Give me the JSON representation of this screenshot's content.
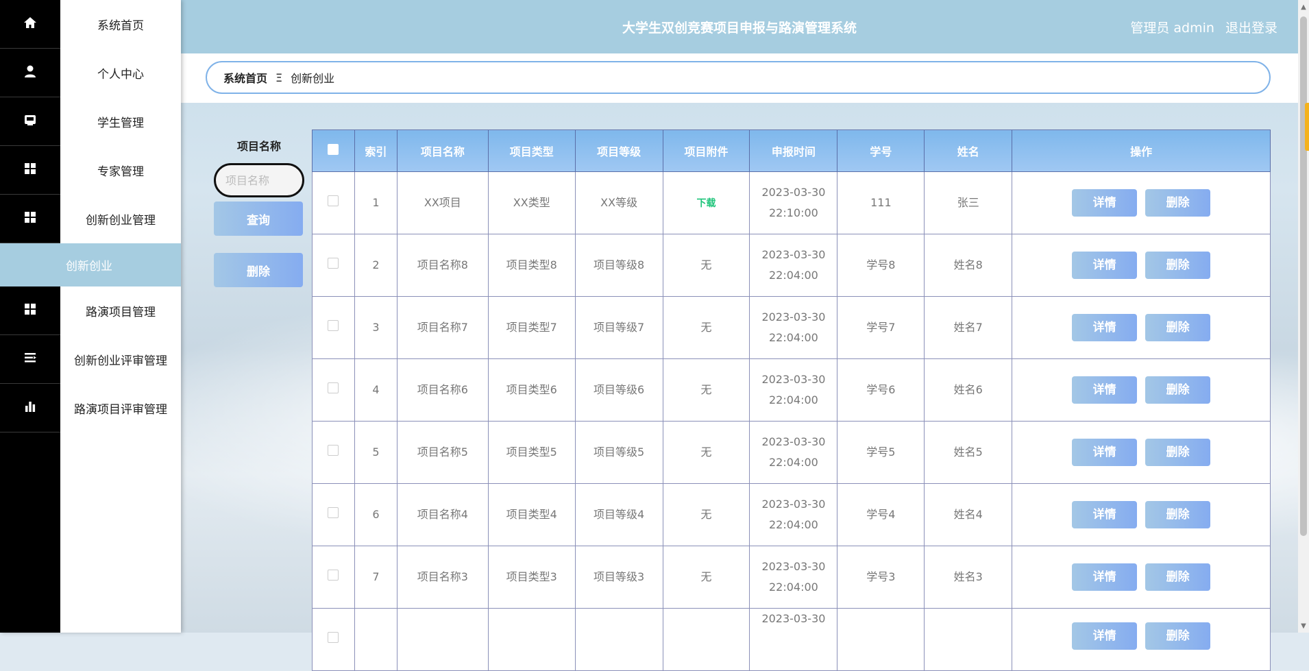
{
  "sidebar": {
    "items": [
      {
        "label": "系统首页",
        "icon": "home-icon"
      },
      {
        "label": "个人中心",
        "icon": "user-icon"
      },
      {
        "label": "学生管理",
        "icon": "inbox-icon"
      },
      {
        "label": "专家管理",
        "icon": "grid-icon"
      },
      {
        "label": "创新创业管理",
        "icon": "grid-icon"
      },
      {
        "label": "路演项目管理",
        "icon": "grid-icon"
      },
      {
        "label": "创新创业评审管理",
        "icon": "list-icon"
      },
      {
        "label": "路演项目评审管理",
        "icon": "bar-chart-icon"
      }
    ],
    "active_sub": "创新创业"
  },
  "header": {
    "title": "大学生双创竞赛项目申报与路演管理系统",
    "user": "管理员 admin",
    "logout": "退出登录"
  },
  "breadcrumb": {
    "home": "系统首页",
    "sep": "Ξ",
    "current": "创新创业"
  },
  "search": {
    "label": "项目名称",
    "placeholder": "项目名称",
    "query_button": "查询",
    "delete_button": "删除"
  },
  "table": {
    "headers": [
      "索引",
      "项目名称",
      "项目类型",
      "项目等级",
      "项目附件",
      "申报时间",
      "学号",
      "姓名",
      "操作"
    ],
    "rows": [
      {
        "idx": "1",
        "name": "XX项目",
        "type": "XX类型",
        "level": "XX等级",
        "file": "下载",
        "date": "2023-03-30",
        "time": "22:10:00",
        "sid": "111",
        "sname": "张三"
      },
      {
        "idx": "2",
        "name": "项目名称8",
        "type": "项目类型8",
        "level": "项目等级8",
        "file": "无",
        "date": "2023-03-30",
        "time": "22:04:00",
        "sid": "学号8",
        "sname": "姓名8"
      },
      {
        "idx": "3",
        "name": "项目名称7",
        "type": "项目类型7",
        "level": "项目等级7",
        "file": "无",
        "date": "2023-03-30",
        "time": "22:04:00",
        "sid": "学号7",
        "sname": "姓名7"
      },
      {
        "idx": "4",
        "name": "项目名称6",
        "type": "项目类型6",
        "level": "项目等级6",
        "file": "无",
        "date": "2023-03-30",
        "time": "22:04:00",
        "sid": "学号6",
        "sname": "姓名6"
      },
      {
        "idx": "5",
        "name": "项目名称5",
        "type": "项目类型5",
        "level": "项目等级5",
        "file": "无",
        "date": "2023-03-30",
        "time": "22:04:00",
        "sid": "学号5",
        "sname": "姓名5"
      },
      {
        "idx": "6",
        "name": "项目名称4",
        "type": "项目类型4",
        "level": "项目等级4",
        "file": "无",
        "date": "2023-03-30",
        "time": "22:04:00",
        "sid": "学号4",
        "sname": "姓名4"
      },
      {
        "idx": "7",
        "name": "项目名称3",
        "type": "项目类型3",
        "level": "项目等级3",
        "file": "无",
        "date": "2023-03-30",
        "time": "22:04:00",
        "sid": "学号3",
        "sname": "姓名3"
      },
      {
        "idx": "",
        "name": "",
        "type": "",
        "level": "",
        "file": "",
        "date": "2023-03-30",
        "time": "",
        "sid": "",
        "sname": ""
      }
    ],
    "detail_label": "详情",
    "delete_label": "删除"
  },
  "colors": {
    "accent": "#a6cde0",
    "header_gradient_start": "#7fb8ec",
    "download_green": "#1ec47a"
  }
}
